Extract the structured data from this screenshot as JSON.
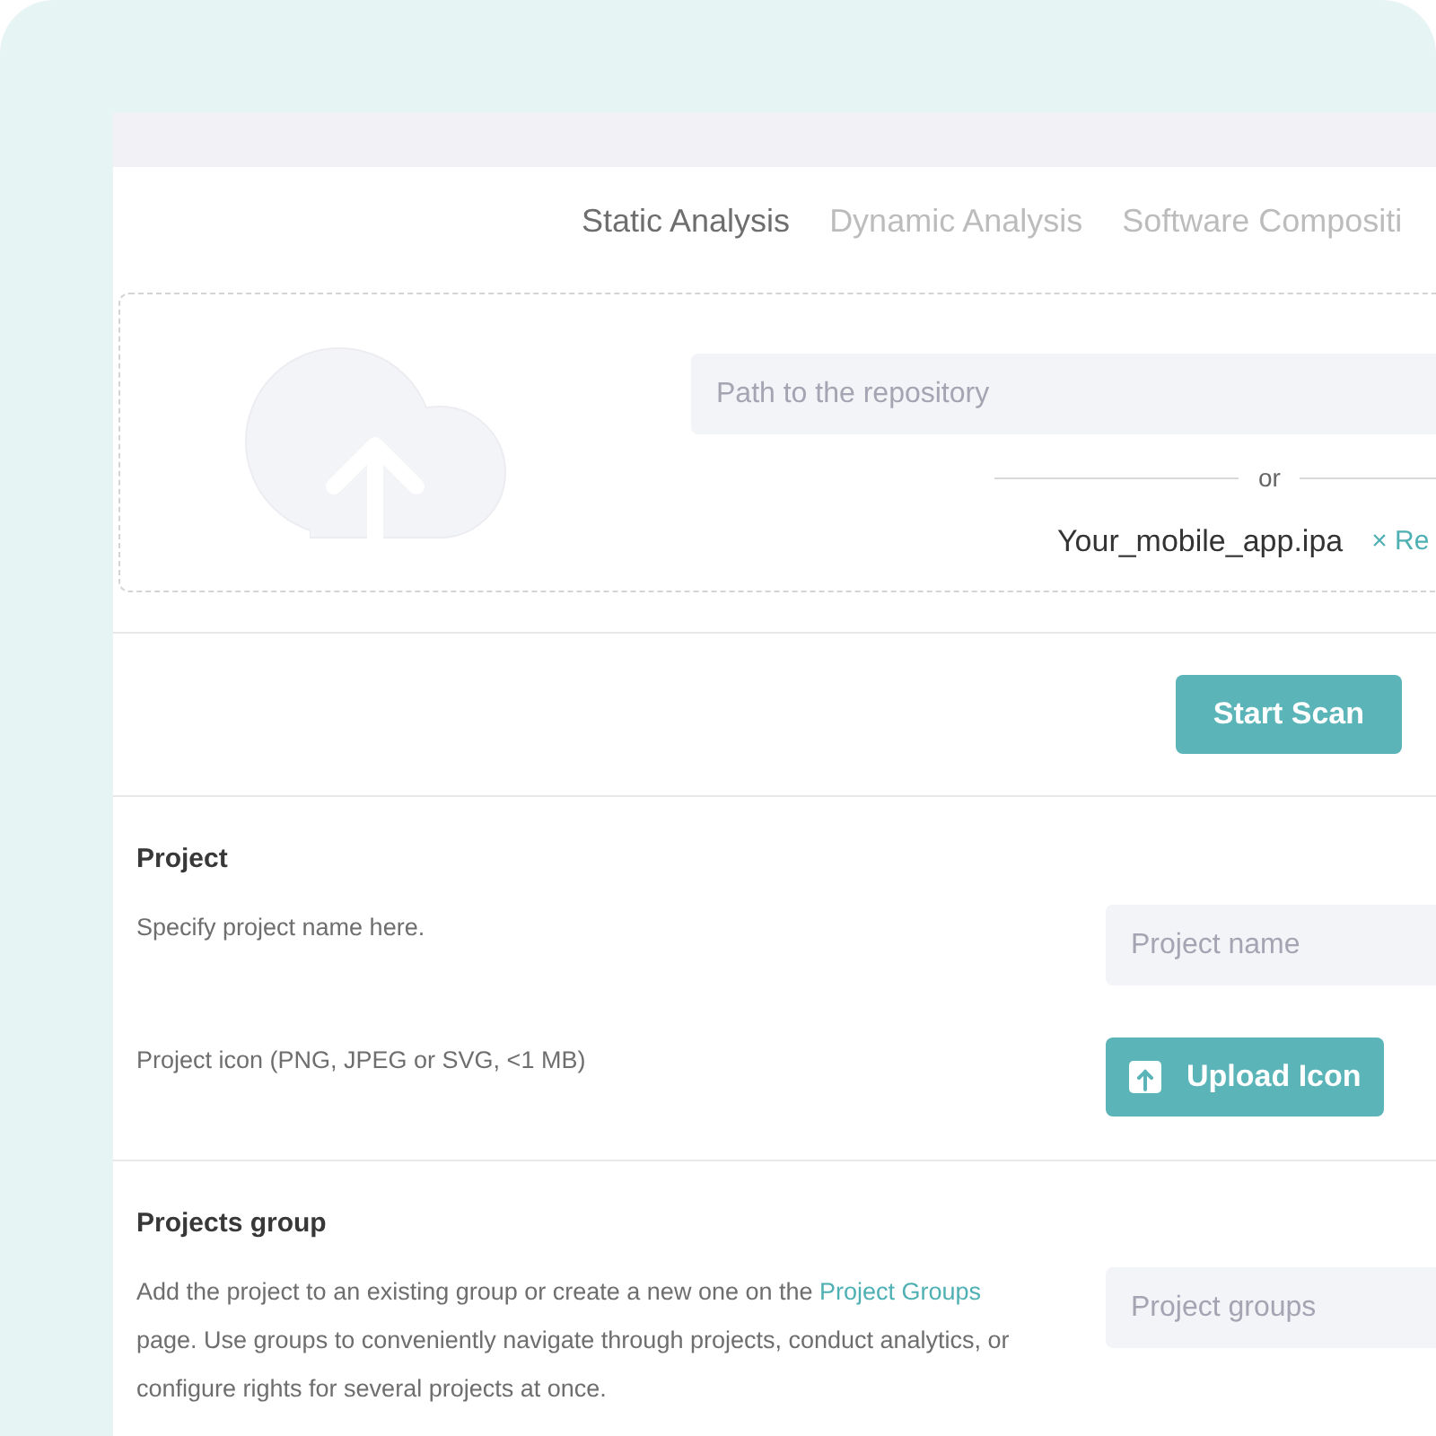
{
  "tabs": [
    {
      "label": "Static Analysis",
      "selected": true
    },
    {
      "label": "Dynamic Analysis",
      "selected": false
    },
    {
      "label": "Software Compositi",
      "selected": false
    }
  ],
  "upload": {
    "repository_field": {
      "placeholder": "Path to the repository"
    },
    "separator": "or",
    "file": {
      "name": "Your_mobile_app.ipa",
      "remove_link": "× Re"
    }
  },
  "actions": {
    "start_button": "Start Scan"
  },
  "sections": [
    {
      "title": "Project",
      "rows": [
        {
          "kind": "input",
          "description": "Specify project name here.",
          "placeholder": "Project name"
        },
        {
          "kind": "upload",
          "description": "Project icon (PNG, JPEG or SVG, <1 MB)",
          "button": "Upload Icon"
        }
      ]
    },
    {
      "title": "Projects group",
      "rows": [
        {
          "kind": "input",
          "description": "Add the project to an existing group or create a new one on the",
          "link": "Project Groups",
          "description_after": "page. Use groups to conveniently navigate through projects, conduct analytics, or configure rights for several projects at once.",
          "placeholder": "Project groups"
        }
      ]
    }
  ]
}
